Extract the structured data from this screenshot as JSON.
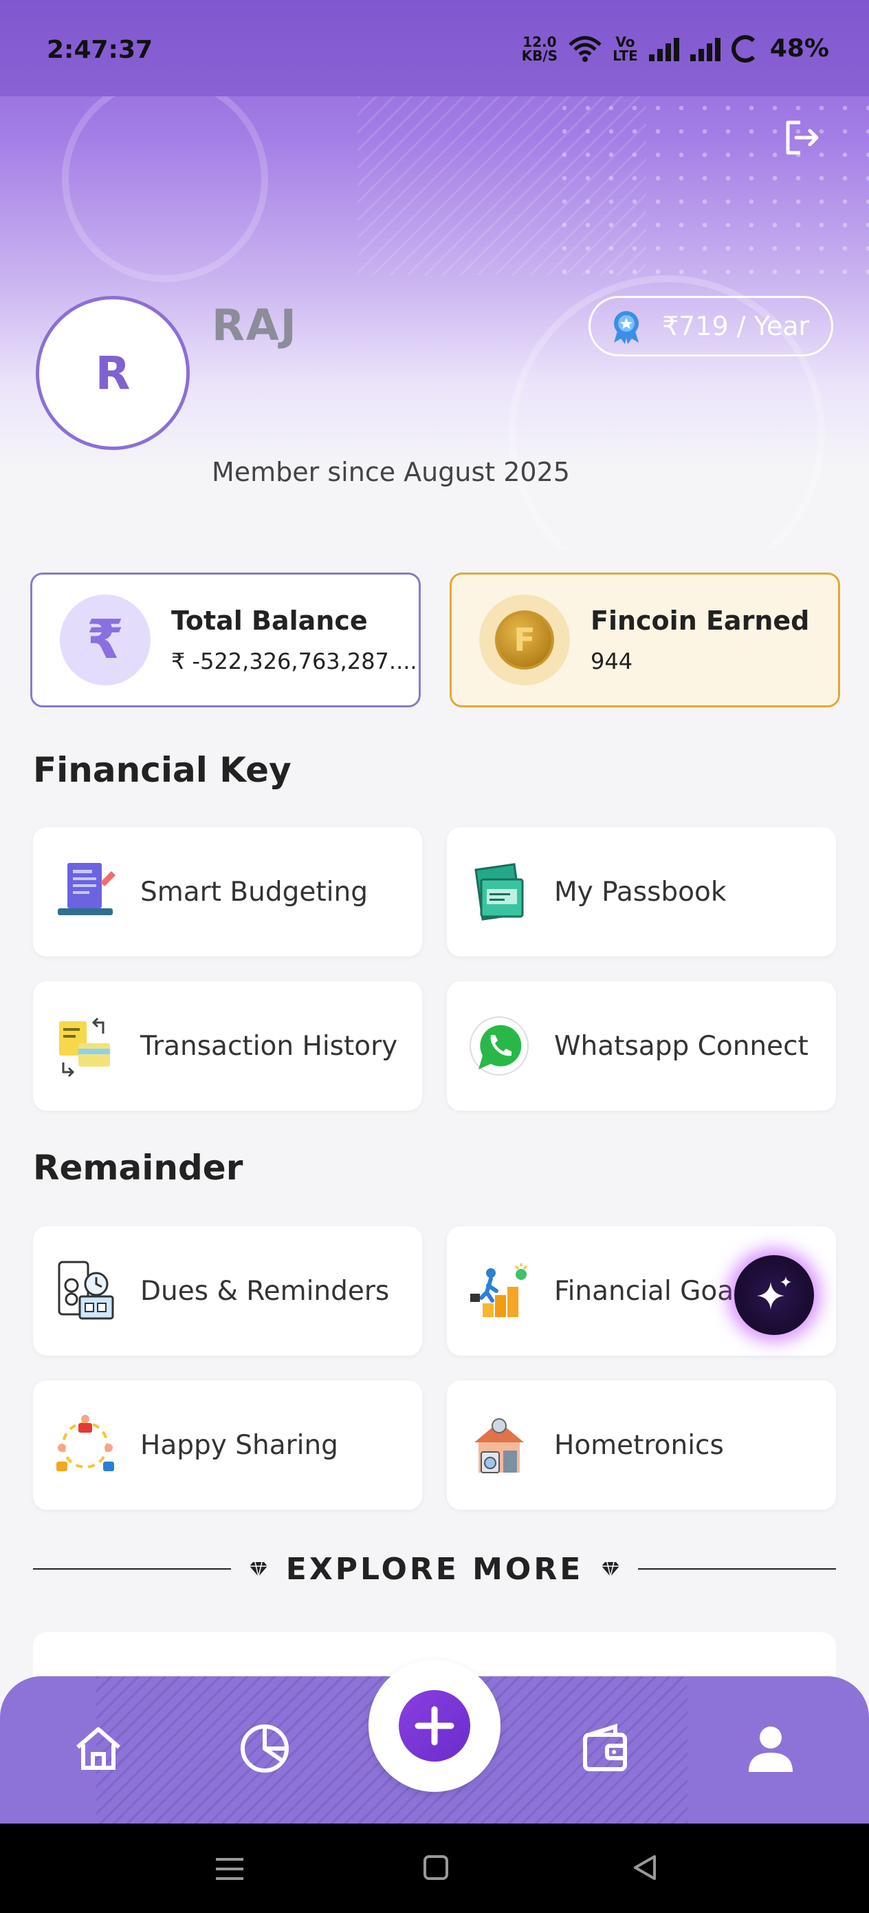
{
  "status_bar": {
    "time": "2:47:37",
    "net_speed_value": "12.0",
    "net_speed_unit": "KB/S",
    "volte_top": "Vo",
    "volte_bottom": "LTE",
    "battery": "48%"
  },
  "profile": {
    "avatar_initial": "R",
    "name": "RAJ",
    "member_since": "Member since August 2025",
    "plan": "₹719 / Year"
  },
  "stats": {
    "balance_icon": "₹",
    "balance_title": "Total Balance",
    "balance_value": "₹ -522,326,763,287....",
    "coins_title": "Fincoin Earned",
    "coins_value": "944",
    "coin_letter": "F"
  },
  "financial_key": {
    "title": "Financial Key",
    "items": [
      {
        "label": "Smart Budgeting",
        "icon": "budget-laptop-icon"
      },
      {
        "label": "My Passbook",
        "icon": "passbook-icon"
      },
      {
        "label": "Transaction History",
        "icon": "transaction-history-icon"
      },
      {
        "label": "Whatsapp Connect",
        "icon": "whatsapp-icon"
      }
    ]
  },
  "remainder": {
    "title": "Remainder",
    "items": [
      {
        "label": "Dues & Reminders",
        "icon": "dues-reminders-icon"
      },
      {
        "label": "Financial Goa",
        "icon": "financial-goals-icon"
      },
      {
        "label": "Happy Sharing",
        "icon": "happy-sharing-icon"
      },
      {
        "label": "Hometronics",
        "icon": "hometronics-icon"
      }
    ]
  },
  "explore": {
    "label": "EXPLORE MORE"
  },
  "bottom_nav": {
    "items": [
      "home-icon",
      "pie-chart-icon",
      "add-icon",
      "wallet-icon",
      "profile-icon"
    ],
    "active": "profile-icon"
  },
  "colors": {
    "accent": "#8d73d8",
    "header": "#8a5fd6",
    "coin_border": "#e2a83a",
    "balance_border": "#8b78c8"
  }
}
